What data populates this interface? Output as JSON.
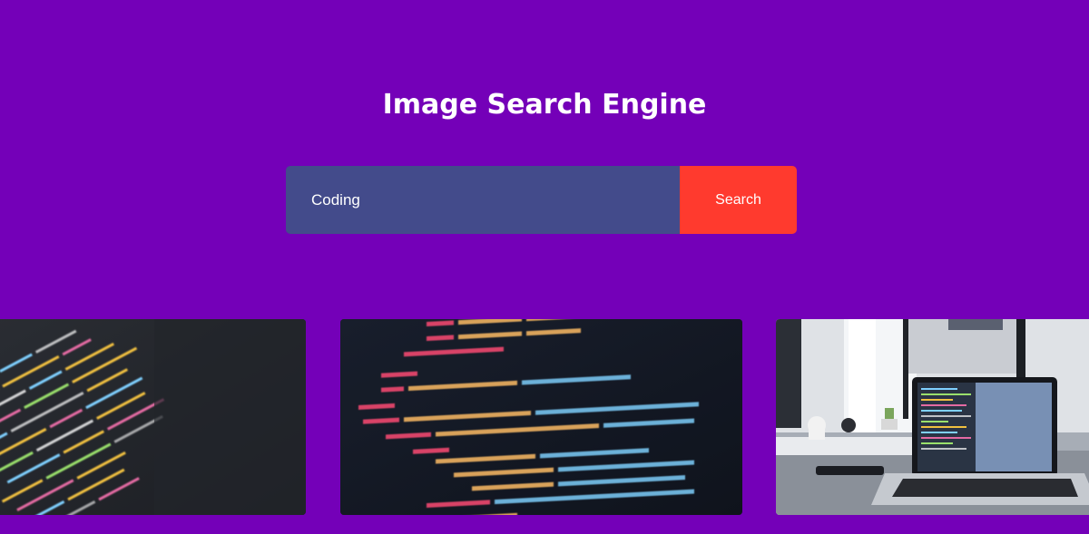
{
  "header": {
    "title": "Image Search Engine"
  },
  "search": {
    "value": "Coding",
    "button_label": "Search"
  },
  "results": [
    {
      "kind": "blurred colorful source code on a dark screen"
    },
    {
      "kind": "HTML / SVG markup in a code editor"
    },
    {
      "kind": "laptop with code on a desk by a window"
    }
  ],
  "colors": {
    "background": "#7400b8",
    "input_background": "#434b8b",
    "button_background": "#ff3a2e",
    "text": "#ffffff"
  }
}
